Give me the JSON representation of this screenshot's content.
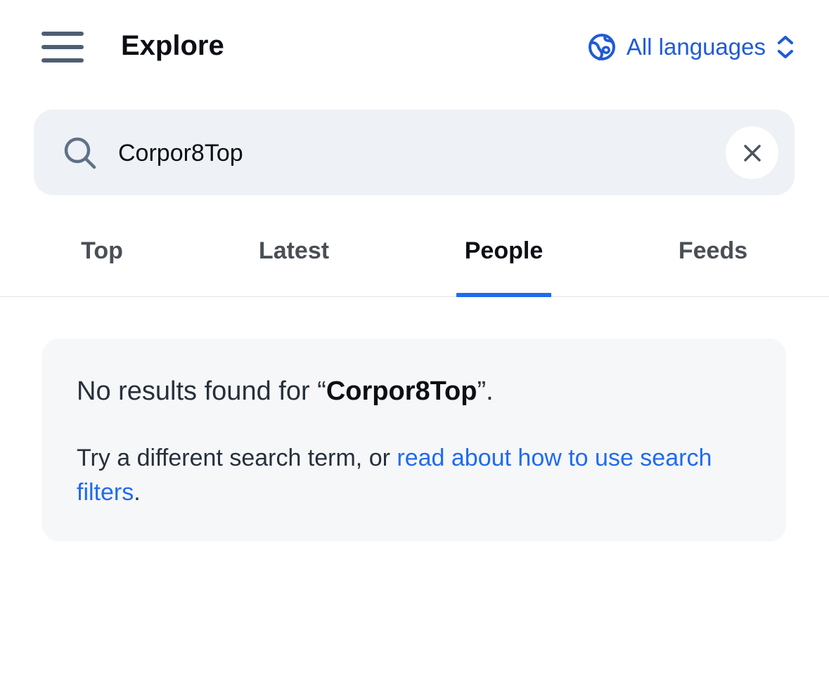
{
  "header": {
    "menu_icon": "hamburger-menu-icon",
    "title": "Explore",
    "language_icon": "globe-icon",
    "language_label": "All languages",
    "language_chevron_icon": "chevron-up-down-icon"
  },
  "search": {
    "icon": "search-icon",
    "value": "Corpor8Top",
    "placeholder": "",
    "clear_icon": "close-icon"
  },
  "tabs": [
    {
      "label": "Top",
      "active": false
    },
    {
      "label": "Latest",
      "active": false
    },
    {
      "label": "People",
      "active": true
    },
    {
      "label": "Feeds",
      "active": false
    }
  ],
  "results": {
    "heading_prefix": "No results found for “",
    "heading_term": "Corpor8Top",
    "heading_suffix": "”.",
    "body_prefix": "Try a different search term, or ",
    "body_link": "read about how to use search filters",
    "body_suffix": "."
  },
  "colors": {
    "accent": "#1f6bf0",
    "link": "#1f5bd6",
    "search_background": "#eef1f5",
    "card_background": "#f6f7f9",
    "menu_icon": "#4f5f72"
  }
}
